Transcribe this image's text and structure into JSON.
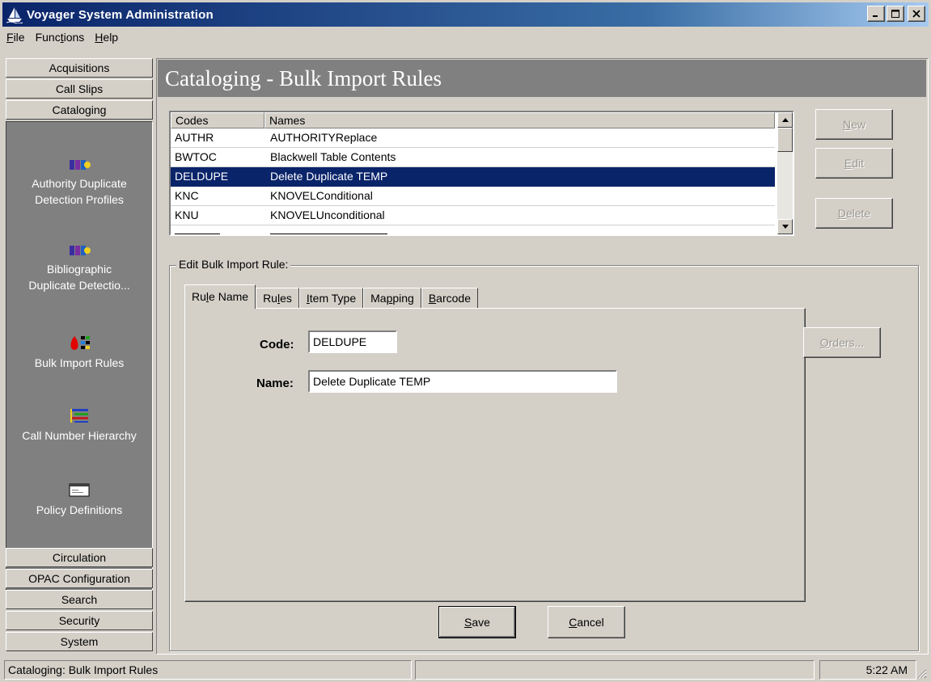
{
  "window": {
    "title": "Voyager System Administration",
    "minimize": "_",
    "maximize": "□",
    "close": "×"
  },
  "menu": [
    {
      "key": "F",
      "rest": "ile"
    },
    {
      "key": "",
      "pre": "Func",
      "underline": "t",
      "post": "ions"
    },
    {
      "key": "H",
      "rest": "elp"
    }
  ],
  "menu_labels": {
    "file_u": "F",
    "file_r": "ile",
    "func_a": "Func",
    "func_u": "t",
    "func_b": "ions",
    "help_u": "H",
    "help_r": "elp"
  },
  "sidebar": {
    "top_modules": [
      "Acquisitions",
      "Call Slips",
      "Cataloging"
    ],
    "items": [
      {
        "label_line1": "Authority Duplicate",
        "label_line2": "Detection Profiles",
        "icon": "duplicate-detection-icon"
      },
      {
        "label_line1": "Bibliographic",
        "label_line2": "Duplicate Detectio...",
        "icon": "duplicate-detection-icon"
      },
      {
        "label_line1": "Bulk Import Rules",
        "label_line2": "",
        "icon": "bulk-import-icon"
      },
      {
        "label_line1": "Call Number Hierarchy",
        "label_line2": "",
        "icon": "hierarchy-icon"
      },
      {
        "label_line1": "Policy Definitions",
        "label_line2": "",
        "icon": "policy-icon"
      }
    ],
    "bottom_modules": [
      "Circulation",
      "OPAC Configuration",
      "Search",
      "Security",
      "System"
    ]
  },
  "header": {
    "title": "Cataloging - Bulk Import Rules"
  },
  "rules_list": {
    "columns": [
      "Codes",
      "Names"
    ],
    "rows": [
      {
        "code": "AUTHR",
        "name": "AUTHORITYReplace"
      },
      {
        "code": "BWTOC",
        "name": "Blackwell Table Contents"
      },
      {
        "code": "DELDUPE",
        "name": "Delete Duplicate TEMP"
      },
      {
        "code": "KNC",
        "name": "KNOVELConditional"
      },
      {
        "code": "KNU",
        "name": "KNOVELUnconditional"
      }
    ],
    "selected_index": 2
  },
  "actions": {
    "new_u": "N",
    "new_r": "ew",
    "edit_u": "E",
    "edit_r": "dit",
    "delete_u": "D",
    "delete_r": "elete",
    "orders_u": "O",
    "orders_r": "rders..."
  },
  "edit_group": {
    "label": "Edit  Bulk Import Rule:",
    "tabs": [
      {
        "pre": "Ru",
        "u": "l",
        "post": "e Name"
      },
      {
        "pre": "Ru",
        "u": "l",
        "post": "es"
      },
      {
        "pre": "",
        "u": "I",
        "post": "tem Type"
      },
      {
        "pre": "Ma",
        "u": "p",
        "post": "ping"
      },
      {
        "pre": "",
        "u": "B",
        "post": "arcode"
      }
    ],
    "code_label": "Code:",
    "code_value": "DELDUPE",
    "name_label": "Name:",
    "name_value": "Delete Duplicate TEMP",
    "save_u": "S",
    "save_r": "ave",
    "cancel_u": "C",
    "cancel_r": "ancel"
  },
  "status": {
    "left": "Cataloging:  Bulk Import Rules",
    "middle": "",
    "time": "5:22 AM"
  },
  "colors": {
    "selection": "#0a246a",
    "titlebar": "#0a246a",
    "panel": "#808080",
    "face": "#d4d0c8"
  }
}
